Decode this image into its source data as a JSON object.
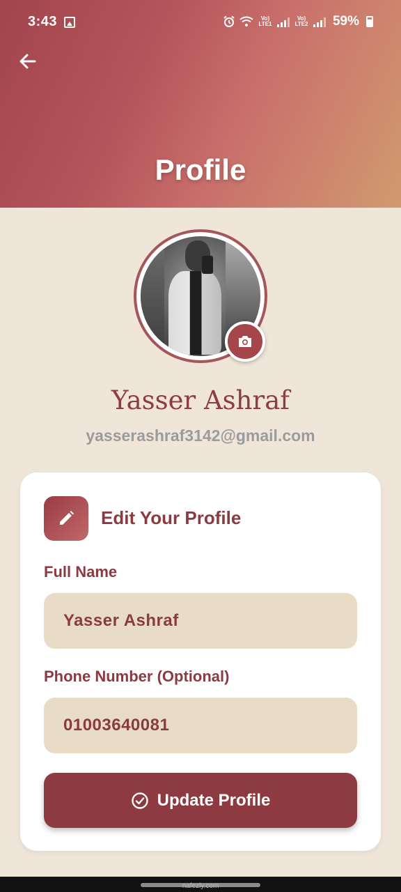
{
  "status_bar": {
    "time": "3:43",
    "lte1": "Vo) LTE1",
    "lte2": "Vo) LTE2",
    "battery": "59%"
  },
  "header": {
    "title": "Profile",
    "gradient": [
      "#a2454c",
      "#d19a6e"
    ]
  },
  "profile": {
    "name": "Yasser Ashraf",
    "email": "yasserashraf3142@gmail.com"
  },
  "edit_card": {
    "title": "Edit Your Profile",
    "full_name_label": "Full Name",
    "full_name_value": "Yasser Ashraf",
    "phone_label": "Phone Number (Optional)",
    "phone_value": "01003640081",
    "update_label": "Update Profile"
  },
  "colors": {
    "accent": "#8d3a41",
    "background": "#efe6d9",
    "input_bg": "#e9dcc7"
  },
  "watermark": "nafezly.com"
}
